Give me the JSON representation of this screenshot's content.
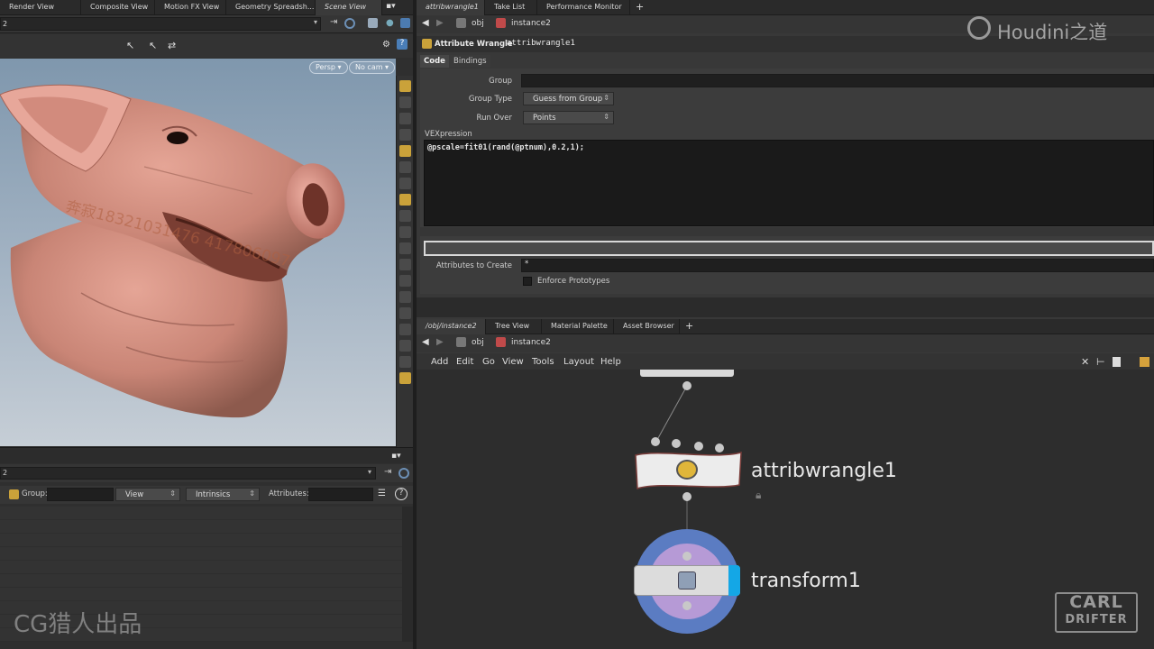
{
  "left_tabs": [
    "Render View",
    "Composite View",
    "Motion FX View",
    "Geometry Spreadsh...",
    "Scene View"
  ],
  "left_path_value": "2",
  "viewport": {
    "persp_label": "Persp ▾",
    "cam_label": "No cam ▾"
  },
  "watermark_text": "奔寂18321031476 417806097",
  "spreadsheet": {
    "path_value": "2",
    "group_label": "Group:",
    "view_label": "View",
    "intrinsics_label": "Intrinsics",
    "attributes_label": "Attributes:"
  },
  "right_tabs": [
    "attribwrangle1",
    "Take List",
    "Performance Monitor"
  ],
  "parm_path": {
    "obj": "obj",
    "node": "instance2"
  },
  "node_header": {
    "type": "Attribute Wrangle",
    "name": "attribwrangle1"
  },
  "parm_tabs": [
    "Code",
    "Bindings"
  ],
  "parms": {
    "group_label": "Group",
    "group_value": "",
    "group_type_label": "Group Type",
    "group_type_value": "Guess from Group",
    "run_over_label": "Run Over",
    "run_over_value": "Points",
    "vex_label": "VEXpression",
    "vex_code": "@pscale=fit01(rand(@ptnum),0.2,1);",
    "attributes_to_create_label": "Attributes to Create",
    "attributes_to_create_value": "*",
    "enforce_prototypes_label": "Enforce Prototypes"
  },
  "network_tabs": [
    "/obj/instance2",
    "Tree View",
    "Material Palette",
    "Asset Browser"
  ],
  "network_path": {
    "obj": "obj",
    "node": "instance2"
  },
  "network_menu": [
    "Add",
    "Edit",
    "Go",
    "View",
    "Tools",
    "Layout",
    "Help"
  ],
  "nodes": {
    "wrangle": "attribwrangle1",
    "transform": "transform1"
  },
  "logo_text": "Houdini之道",
  "bottom_watermark": "CG猎人出品",
  "carl_badge": {
    "line1": "CARL",
    "line2": "DRIFTER"
  }
}
